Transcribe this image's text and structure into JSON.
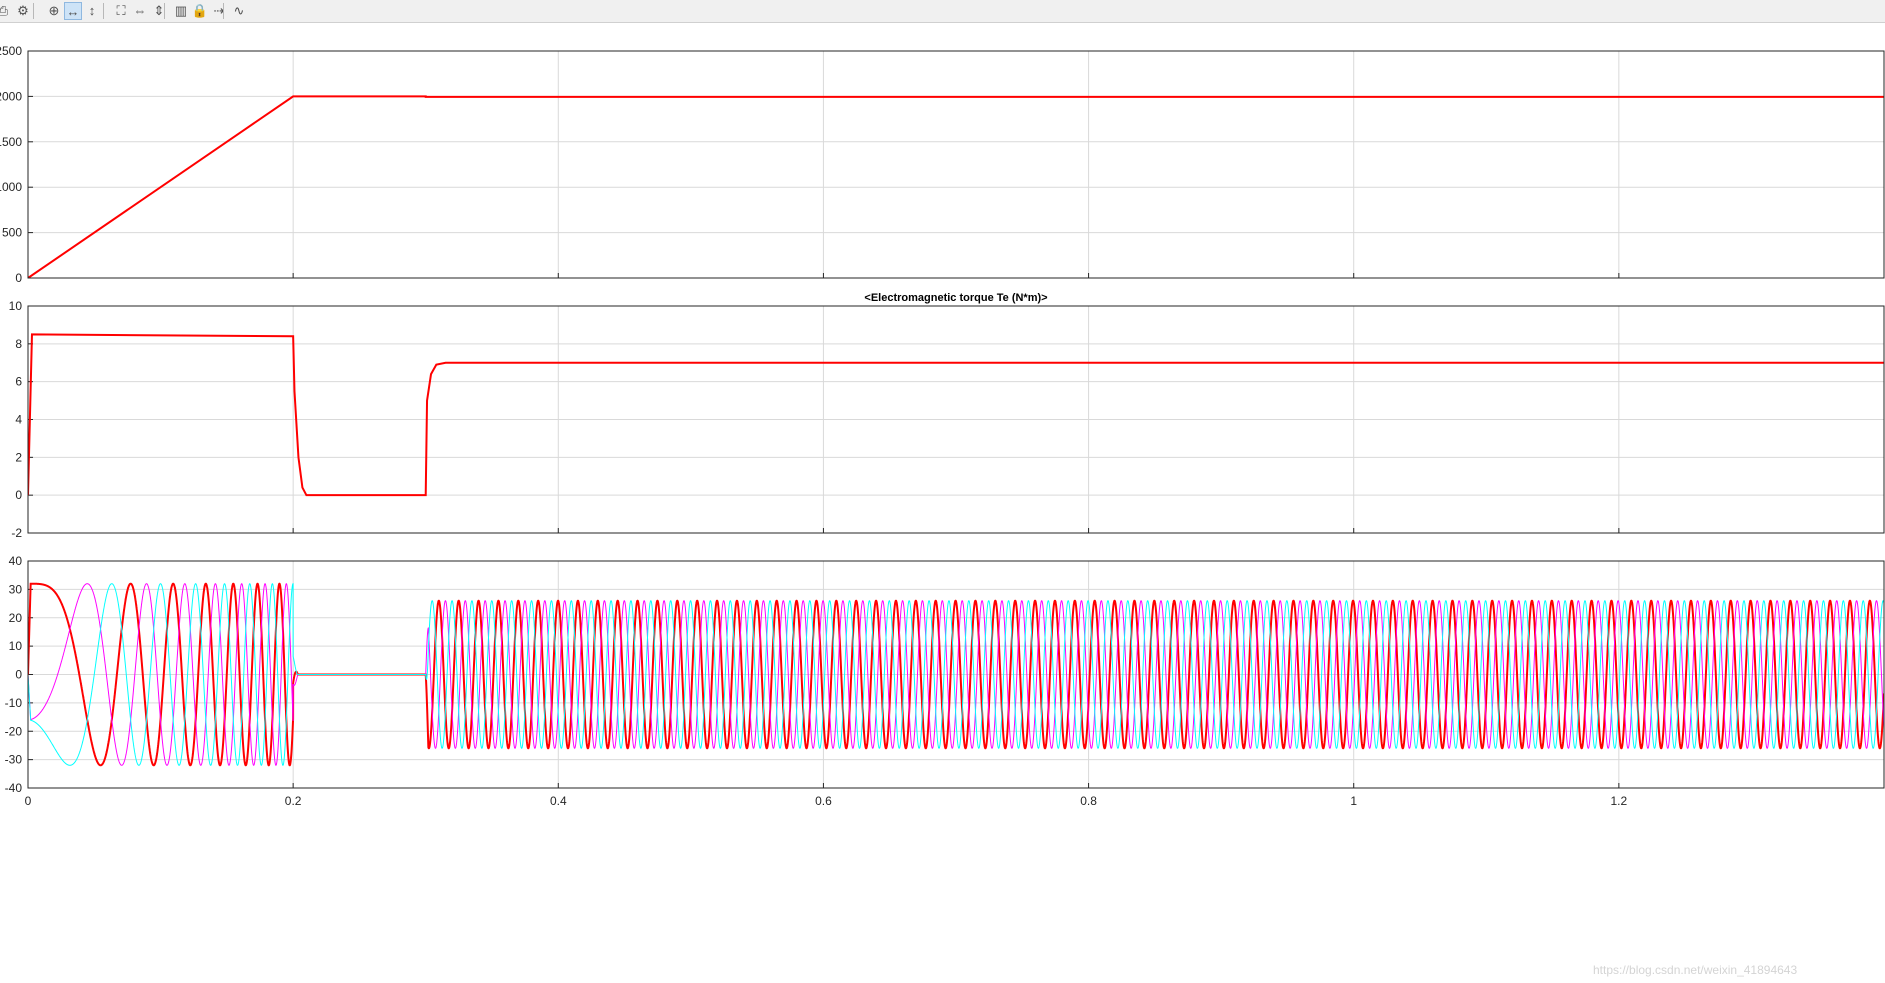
{
  "toolbar": {
    "buttons": [
      {
        "icon": "print-icon"
      },
      {
        "icon": "settings-gear-icon"
      },
      {
        "icon": "zoom-in-icon"
      },
      {
        "icon": "zoom-x-icon",
        "active": true
      },
      {
        "icon": "zoom-y-icon"
      },
      {
        "icon": "fit-to-view-icon"
      },
      {
        "icon": "autoscale-x-icon"
      },
      {
        "icon": "autoscale-y-icon"
      },
      {
        "icon": "save-axes-icon"
      },
      {
        "icon": "lock-icon"
      },
      {
        "icon": "signal-selector-icon"
      },
      {
        "icon": "data-cursor-icon"
      }
    ]
  },
  "colors": {
    "grid": "#d9d9d9",
    "axes": "#262626",
    "red": "#ff0000",
    "magenta": "#ff00ff",
    "cyan": "#00ffff",
    "blue": "#0000ff"
  },
  "watermark": "https://blog.csdn.net/weixin_41894643",
  "chart_data": [
    {
      "type": "line",
      "title": "",
      "xlim": [
        0,
        1.4
      ],
      "ylim": [
        0,
        2500
      ],
      "yticks": [
        "0",
        "500",
        "1000",
        "1500",
        "2000",
        "2500"
      ],
      "grid": true,
      "series": [
        {
          "color": "#ff0000",
          "x": [
            0,
            0.2,
            0.3,
            0.3,
            1.4
          ],
          "y": [
            0,
            2000,
            2000,
            1995,
            1995
          ]
        }
      ]
    },
    {
      "type": "line",
      "title": "<Electromagnetic torque Te (N*m)>",
      "xlim": [
        0,
        1.4
      ],
      "ylim": [
        -2,
        10
      ],
      "yticks": [
        "-2",
        "0",
        "2",
        "4",
        "6",
        "8",
        "10"
      ],
      "grid": true,
      "series": [
        {
          "color": "#ff0000",
          "x": [
            0,
            0.003,
            0.2,
            0.201,
            0.204,
            0.207,
            0.21,
            0.3,
            0.301,
            0.304,
            0.308,
            0.315,
            1.4
          ],
          "y": [
            0,
            8.5,
            8.4,
            5.5,
            2.0,
            0.4,
            0.0,
            0.0,
            5.0,
            6.4,
            6.9,
            7.0,
            7.0
          ]
        }
      ]
    },
    {
      "type": "line",
      "title": "",
      "xlim": [
        0,
        1.4
      ],
      "ylim": [
        -40,
        40
      ],
      "yticks": [
        "-40",
        "-30",
        "-20",
        "-10",
        "0",
        "10",
        "20",
        "30",
        "40"
      ],
      "xticks": [
        "0",
        "0.2",
        "0.4",
        "0.6",
        "0.8",
        "1",
        "1.2"
      ],
      "grid": true,
      "description": "three-phase stator currents",
      "segments": [
        {
          "t_start": 0,
          "t_end": 0.2,
          "amplitude": 32,
          "electrical_freq_hz": [
            0,
            66.7
          ]
        },
        {
          "t_start": 0.2,
          "t_end": 0.3,
          "amplitude": 0,
          "electrical_freq_hz": [
            66.7,
            66.7
          ]
        },
        {
          "t_start": 0.3,
          "t_end": 1.4,
          "amplitude": 26,
          "electrical_freq_hz": [
            66.7,
            66.7
          ]
        }
      ],
      "series": [
        {
          "color": "#ff0000",
          "phase_deg": 90
        },
        {
          "color": "#ff00ff",
          "phase_deg": -30
        },
        {
          "color": "#00ffff",
          "phase_deg": 210
        }
      ]
    }
  ]
}
